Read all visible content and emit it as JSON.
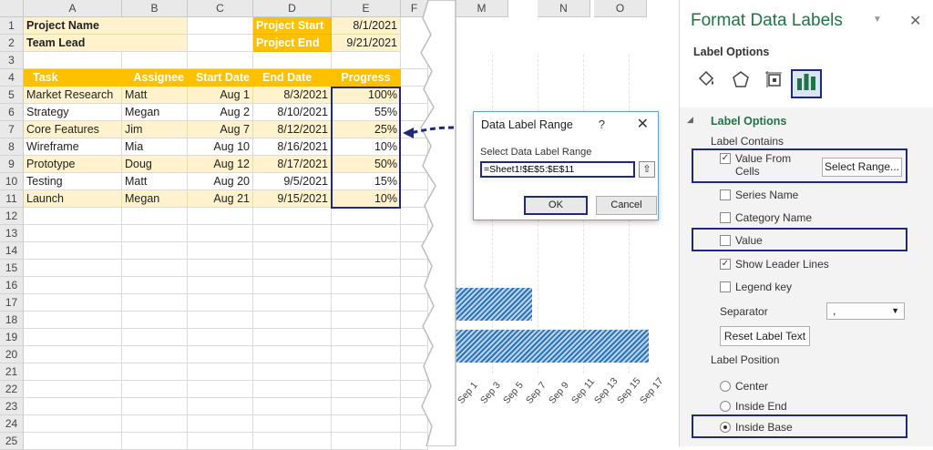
{
  "sheet": {
    "columns": [
      "A",
      "B",
      "C",
      "D",
      "E",
      "F"
    ],
    "rows": [
      "1",
      "2",
      "3",
      "4",
      "5",
      "6",
      "7",
      "8",
      "9",
      "10",
      "11",
      "12",
      "13",
      "14",
      "15",
      "16",
      "17",
      "18",
      "19",
      "20",
      "21",
      "22",
      "23",
      "24",
      "25"
    ],
    "project_name_label": "Project Name",
    "team_lead_label": "Team Lead",
    "project_start_label": "Project Start",
    "project_start_value": "8/1/2021",
    "project_end_label": "Project End",
    "project_end_value": "9/21/2021",
    "headers": [
      "Task",
      "Assignee",
      "Start Date",
      "End Date",
      "Progress"
    ],
    "tasks": [
      [
        "Market Research",
        "Matt",
        "Aug 1",
        "8/3/2021",
        "100%"
      ],
      [
        "Strategy",
        "Megan",
        "Aug 2",
        "8/10/2021",
        "55%"
      ],
      [
        "Core Features",
        "Jim",
        "Aug 7",
        "8/12/2021",
        "25%"
      ],
      [
        "Wireframe",
        "Mia",
        "Aug 10",
        "8/16/2021",
        "10%"
      ],
      [
        "Prototype",
        "Doug",
        "Aug 12",
        "8/17/2021",
        "50%"
      ],
      [
        "Testing",
        "Matt",
        "Aug 20",
        "9/5/2021",
        "15%"
      ],
      [
        "Launch",
        "Megan",
        "Aug 21",
        "9/15/2021",
        "10%"
      ]
    ]
  },
  "chart": {
    "columns": [
      "M",
      "N",
      "O"
    ],
    "x_ticks": [
      "Sep 1",
      "Sep 3",
      "Sep 5",
      "Sep 7",
      "Sep 9",
      "Sep 11",
      "Sep 13",
      "Sep 15",
      "Sep 17"
    ]
  },
  "dialog": {
    "title": "Data Label Range",
    "help": "?",
    "close": "✕",
    "label": "Select Data Label Range",
    "range_value": "=Sheet1!$E$5:$E$11",
    "collapse": "⇧",
    "ok": "OK",
    "cancel": "Cancel"
  },
  "pane": {
    "title": "Format Data Labels",
    "caret": "▼",
    "close": "✕",
    "subtitle": "Label Options",
    "section": "Label Options",
    "label_contains": "Label Contains",
    "value_from_cells": "Value From\nCells",
    "select_range": "Select Range...",
    "series_name": "Series Name",
    "category_name": "Category Name",
    "value": "Value",
    "show_leader_lines": "Show Leader Lines",
    "legend_key": "Legend key",
    "separator_label": "Separator",
    "separator_value": ",",
    "reset_label_text": "Reset Label Text",
    "label_position": "Label Position",
    "center": "Center",
    "inside_end": "Inside End",
    "inside_base": "Inside Base"
  }
}
